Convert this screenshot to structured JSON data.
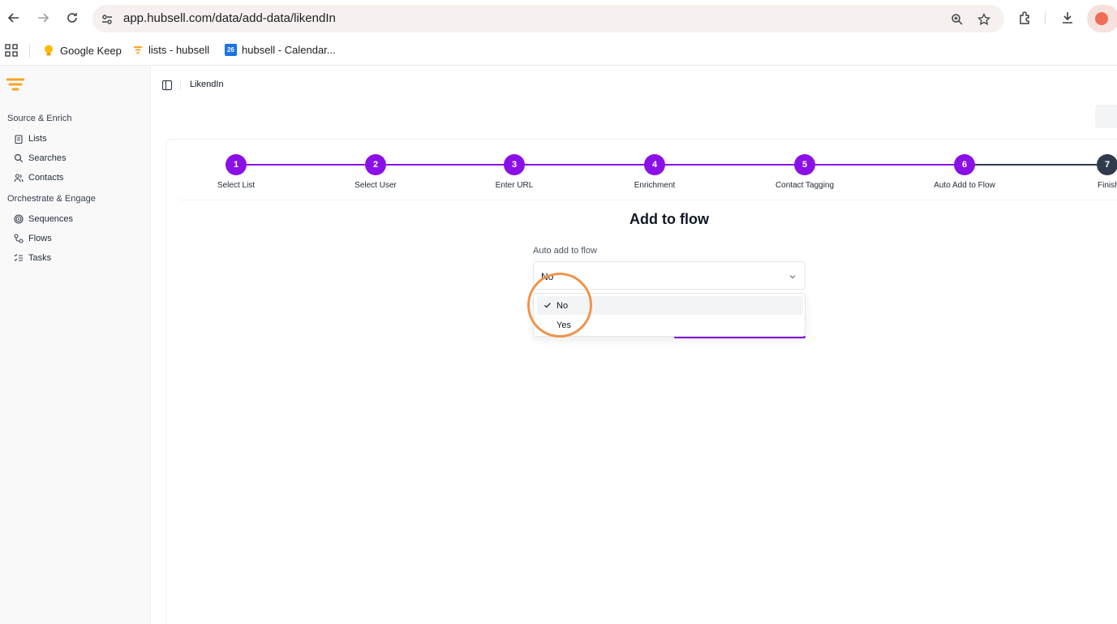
{
  "browser": {
    "url": "app.hubsell.com/data/add-data/likendIn",
    "bookmarks": [
      {
        "label": "Google Keep",
        "icon": "keep-bulb-icon"
      },
      {
        "label": "lists - hubsell",
        "icon": "hubsell-funnel-icon"
      },
      {
        "label": "hubsell - Calendar...",
        "icon": "calendar-icon",
        "badge": "26"
      }
    ]
  },
  "sidebar": {
    "sections": [
      {
        "title": "Source & Enrich",
        "items": [
          {
            "label": "Lists",
            "icon": "clipboard-icon"
          },
          {
            "label": "Searches",
            "icon": "search-icon"
          },
          {
            "label": "Contacts",
            "icon": "users-icon"
          }
        ]
      },
      {
        "title": "Orchestrate & Engage",
        "items": [
          {
            "label": "Sequences",
            "icon": "target-icon"
          },
          {
            "label": "Flows",
            "icon": "flow-icon"
          },
          {
            "label": "Tasks",
            "icon": "tasks-icon"
          }
        ]
      }
    ]
  },
  "header": {
    "breadcrumb": "LikendIn"
  },
  "stepper": {
    "steps": [
      {
        "num": "1",
        "label": "Select List"
      },
      {
        "num": "2",
        "label": "Select User"
      },
      {
        "num": "3",
        "label": "Enter URL"
      },
      {
        "num": "4",
        "label": "Enrichment"
      },
      {
        "num": "5",
        "label": "Contact Tagging"
      },
      {
        "num": "6",
        "label": "Auto Add to Flow"
      },
      {
        "num": "7",
        "label": "Finish"
      }
    ],
    "active_color": "#8b10e8",
    "inactive_color": "#2f3a4a"
  },
  "form": {
    "title": "Add to flow",
    "field_label": "Auto add to flow",
    "selected_value": "No",
    "options": [
      {
        "label": "No",
        "selected": true
      },
      {
        "label": "Yes",
        "selected": false
      }
    ]
  },
  "annotation": {
    "color": "#f0934a"
  }
}
